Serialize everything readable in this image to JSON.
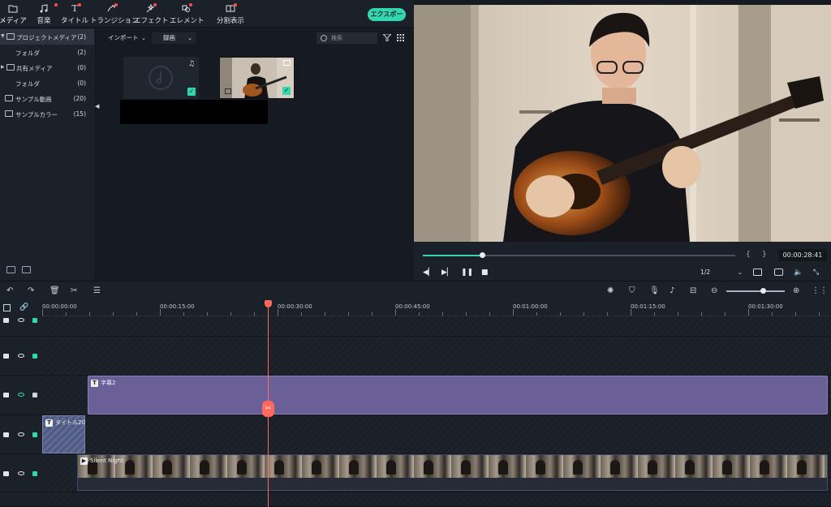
{
  "toolbar": {
    "tabs": [
      {
        "label": "メディア",
        "icon": "folder-icon"
      },
      {
        "label": "音楽",
        "icon": "music-note-icon"
      },
      {
        "label": "タイトル",
        "icon": "text-icon"
      },
      {
        "label": "トランジション",
        "icon": "transition-icon"
      },
      {
        "label": "エフェクト",
        "icon": "effects-icon"
      },
      {
        "label": "エレメント",
        "icon": "element-icon"
      },
      {
        "label": "分割表示",
        "icon": "split-screen-icon"
      }
    ],
    "export_label": "エクスポート"
  },
  "tree": {
    "items": [
      {
        "label": "プロジェクトメディア",
        "count": "(2)"
      },
      {
        "label": "フォルダ",
        "count": "(2)"
      },
      {
        "label": "共有メディア",
        "count": "(0)"
      },
      {
        "label": "フォルダ",
        "count": "(0)"
      },
      {
        "label": "サンプル動画",
        "count": "(20)"
      },
      {
        "label": "サンプルカラー",
        "count": "(15)"
      }
    ]
  },
  "browser": {
    "import_label": "インポート",
    "record_label": "録画",
    "search_placeholder": "検索"
  },
  "player": {
    "timecode": "00:00:28:41",
    "ratio": "1/2",
    "progress": 0.19
  },
  "ruler": {
    "labels": [
      "00:00:00:00",
      "00:00:15:00",
      "00:00:30:00",
      "00:00:45:00",
      "00:01:00:00",
      "00:01:15:00",
      "00:01:30:00"
    ]
  },
  "tracks": {
    "subtitle_clip": "字幕2",
    "title_clip": "タイトル20",
    "video_clip": "Silent Night"
  },
  "colors": {
    "accent": "#34d6b0",
    "playhead": "#ff6a5c",
    "subtitle_clip": "#6b5f98"
  }
}
